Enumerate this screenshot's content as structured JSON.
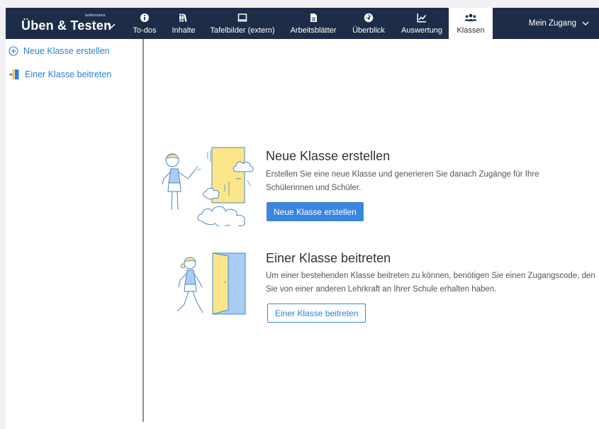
{
  "brand": {
    "small": "bettermarks",
    "title": "Üben & Testen"
  },
  "nav": [
    {
      "label": "To-dos",
      "icon": "info-icon"
    },
    {
      "label": "Inhalte",
      "icon": "books-icon"
    },
    {
      "label": "Tafelbilder (extern)",
      "icon": "monitor-icon"
    },
    {
      "label": "Arbeitsblätter",
      "icon": "document-icon"
    },
    {
      "label": "Überblick",
      "icon": "gauge-icon"
    },
    {
      "label": "Auswertung",
      "icon": "chart-line-icon"
    },
    {
      "label": "Klassen",
      "icon": "users-icon",
      "active": true
    }
  ],
  "account": {
    "label": "Mein Zugang"
  },
  "sidebar": {
    "items": [
      {
        "label": "Neue Klasse erstellen",
        "icon": "plus-circle-icon"
      },
      {
        "label": "Einer Klasse beitreten",
        "icon": "door-enter-icon"
      }
    ]
  },
  "main": {
    "create": {
      "title": "Neue Klasse erstellen",
      "text": "Erstellen Sie eine neue Klasse und generieren Sie danach Zugänge für Ihre Schülerinnen und Schüler.",
      "button": "Neue Klasse erstellen"
    },
    "join": {
      "title": "Einer Klasse beitreten",
      "text": "Um einer bestehenden Klasse beitreten zu können, benötigen Sie einen Zugangscode, den Sie von einer anderen Lehrkraft an Ihrer Schule erhalten haben.",
      "button": "Einer Klasse beitreten"
    }
  },
  "colors": {
    "topbar": "#1e2d47",
    "accent": "#3b86de",
    "link": "#2a7fd8",
    "door_yellow": "#fbe78a",
    "door_blue": "#a9cdf3"
  }
}
